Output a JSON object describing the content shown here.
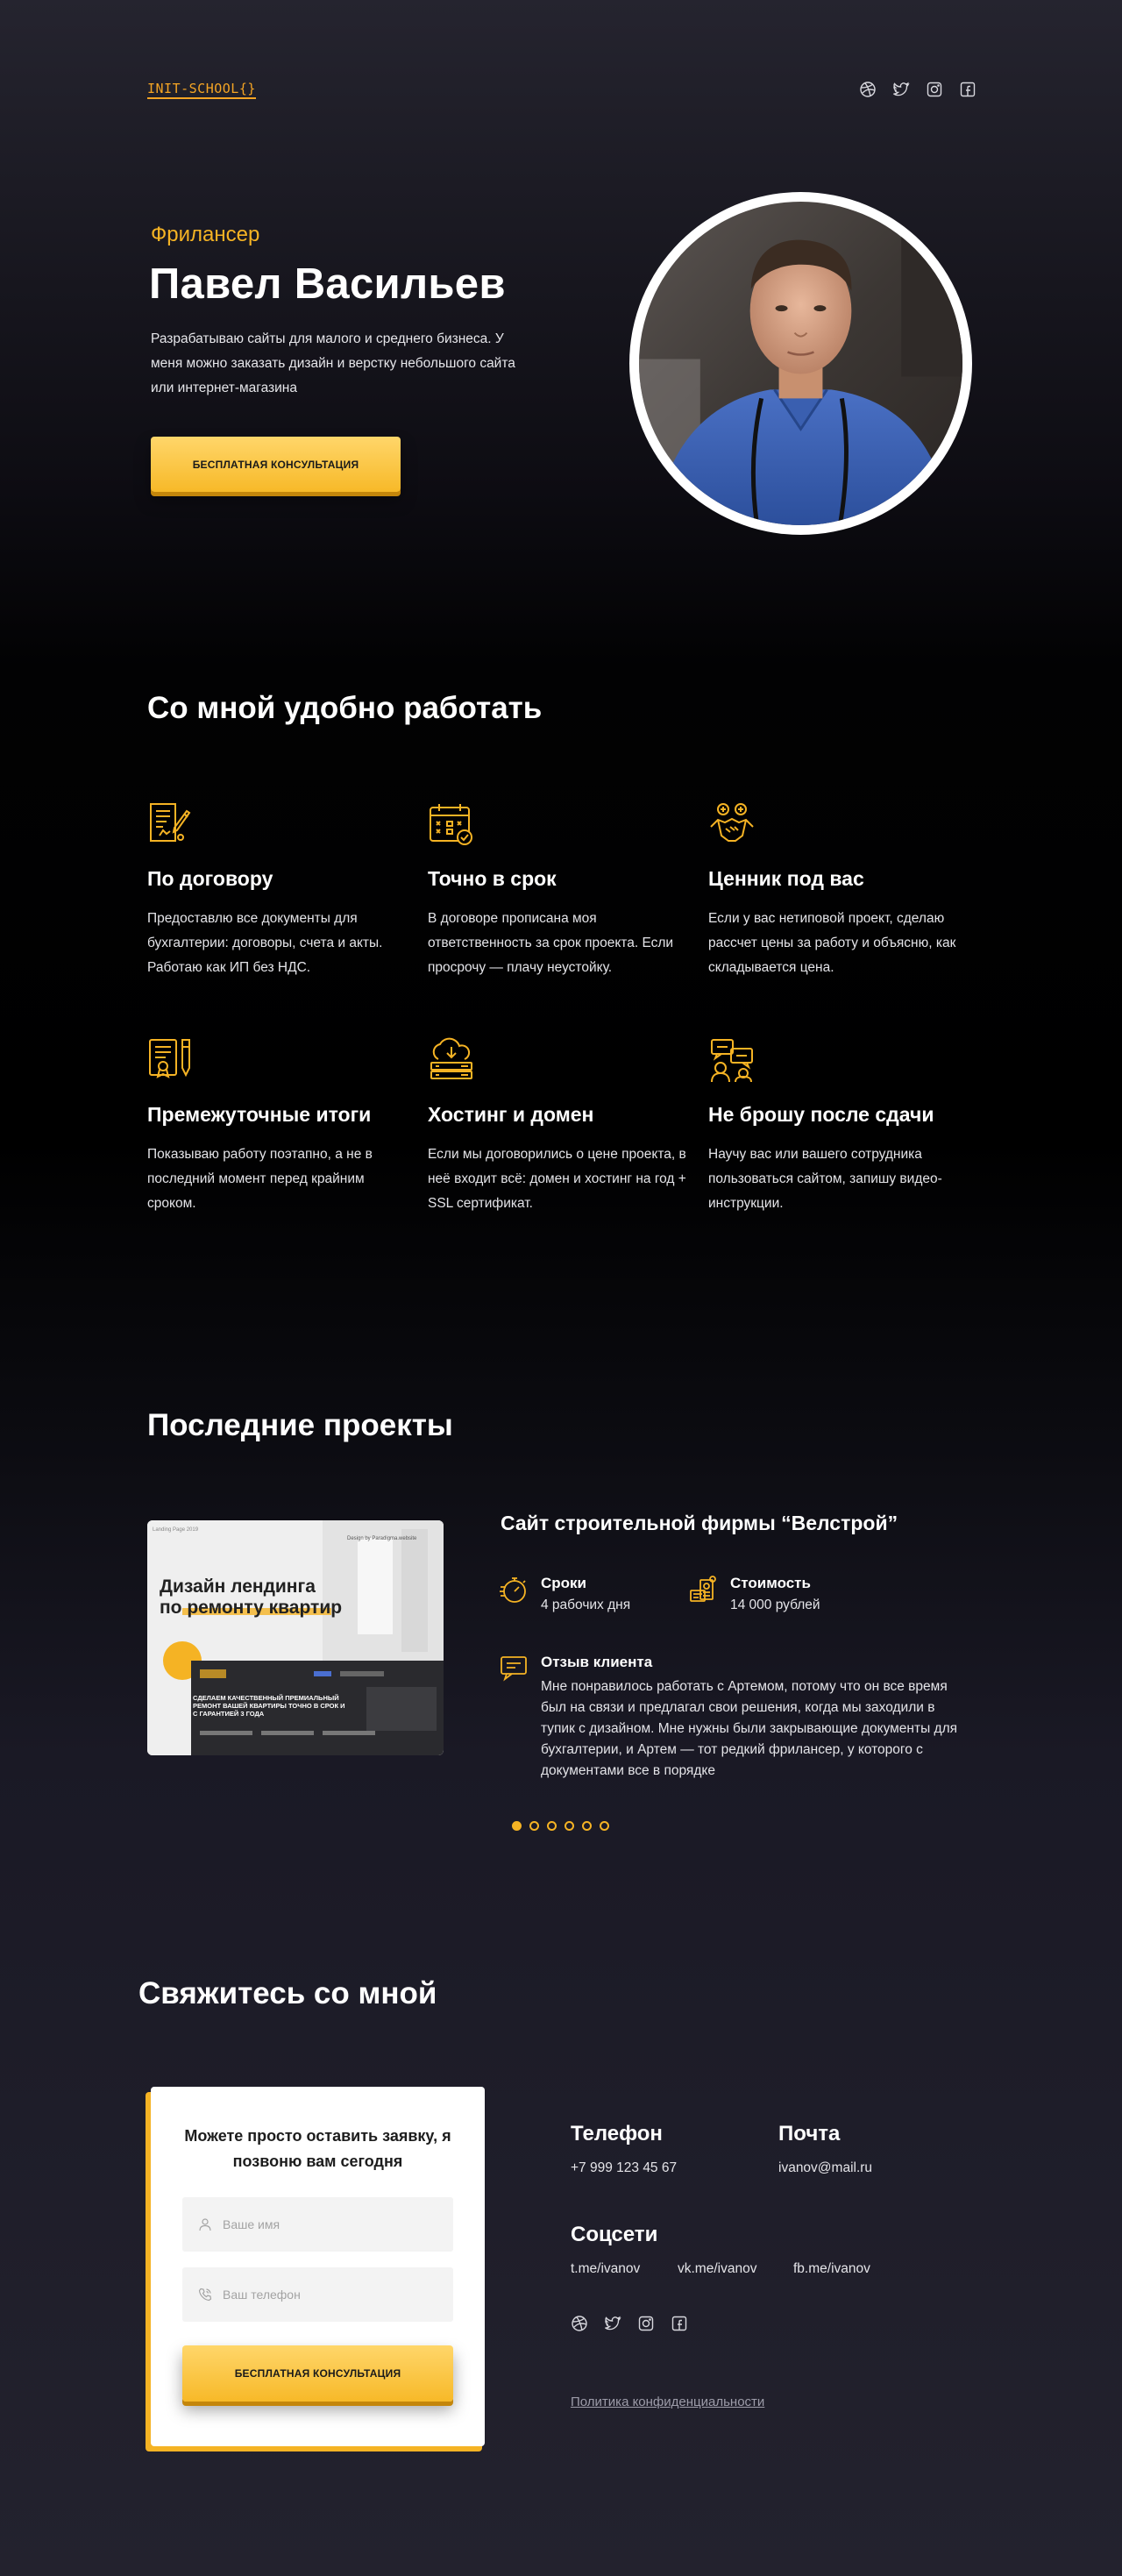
{
  "header": {
    "logo": "INIT-SCHOOL{}",
    "social": [
      "dribbble-icon",
      "twitter-icon",
      "instagram-icon",
      "facebook-icon"
    ]
  },
  "hero": {
    "subtitle": "Фрилансер",
    "title": "Павел Васильев",
    "description": "Разрабатываю сайты для малого и среднего бизнеса. У меня можно заказать дизайн и верстку небольшого сайта или интернет-магазина",
    "button": "БЕСПЛАТНАЯ КОНСУЛЬТАЦИЯ"
  },
  "benefits": {
    "heading": "Со мной удобно работать",
    "items": [
      {
        "title": "По договору",
        "text": "Предоставлю все документы для бухгалтерии: договоры, счета и акты. Работаю как ИП без НДС.",
        "icon": "contract-icon"
      },
      {
        "title": "Точно в срок",
        "text": "В договоре прописана моя ответственность за срок проекта. Если просрочу — плачу неустойку.",
        "icon": "calendar-icon"
      },
      {
        "title": "Ценник под вас",
        "text": "Если у вас нетиповой проект, сделаю рассчет цены за работу и объясню, как складывается цена.",
        "icon": "handshake-icon"
      },
      {
        "title": "Премежуточные итоги",
        "text": "Показываю работу поэтапно, а не в последний момент перед крайним сроком.",
        "icon": "certificate-icon"
      },
      {
        "title": "Хостинг и домен",
        "text": "Если мы договорились о цене проекта, в неё входит всё: домен и хостинг на год + SSL сертификат.",
        "icon": "cloud-server-icon"
      },
      {
        "title": "Не брошу после сдачи",
        "text": "Научу вас или вашего сотрудника пользоваться сайтом, запишу видео-инструкции.",
        "icon": "support-chat-icon"
      }
    ]
  },
  "projects": {
    "heading": "Последние проекты",
    "image": {
      "tag": "Landing Page 2019",
      "credit": "Design by Paradigma.website",
      "headline_1": "Дизайн лендинга",
      "headline_2": "по ремонту квартир",
      "screen_text": "СДЕЛАЕМ КАЧЕСТВЕННЫЙ ПРЕМИАЛЬНЫЙ РЕМОНТ ВАШЕЙ КВАРТИРЫ ТОЧНО В СРОК И С ГАРАНТИЕЙ 3 ГОДА"
    },
    "title": "Сайт строительной фирмы “Велстрой”",
    "deadline_label": "Сроки",
    "deadline_value": "4 рабочих дня",
    "cost_label": "Стоимость",
    "cost_value": "14 000 рублей",
    "review_label": "Отзыв клиента",
    "review_text": "Мне понравилось работать с Артемом, потому что он все время был на связи и предлагал свои решения, когда мы заходили в тупик с дизайном. Мне нужны были закрывающие документы для бухгалтерии, и Артем — тот редкий фрилансер, у которого с документами все в порядке",
    "slides_total": 6,
    "slide_active": 1
  },
  "contact": {
    "heading": "Свяжитесь со мной",
    "form_title": "Можете просто оставить заявку, я позвоню вам сегодня",
    "name_placeholder": "Ваше имя",
    "phone_placeholder": "Ваш телефон",
    "button": "БЕСПЛАТНАЯ КОНСУЛЬТАЦИЯ",
    "phone_label": "Телефон",
    "phone": "+7 999 123 45 67",
    "email_label": "Почта",
    "email": "ivanov@mail.ru",
    "social_label": "Соцсети",
    "telegram": "t.me/ivanov",
    "vk": "vk.me/ivanov",
    "facebook": "fb.me/ivanov",
    "policy": "Политика конфиденциальности"
  },
  "colors": {
    "accent": "#f5b324",
    "background": "#22212d",
    "text": "#ffffff"
  }
}
